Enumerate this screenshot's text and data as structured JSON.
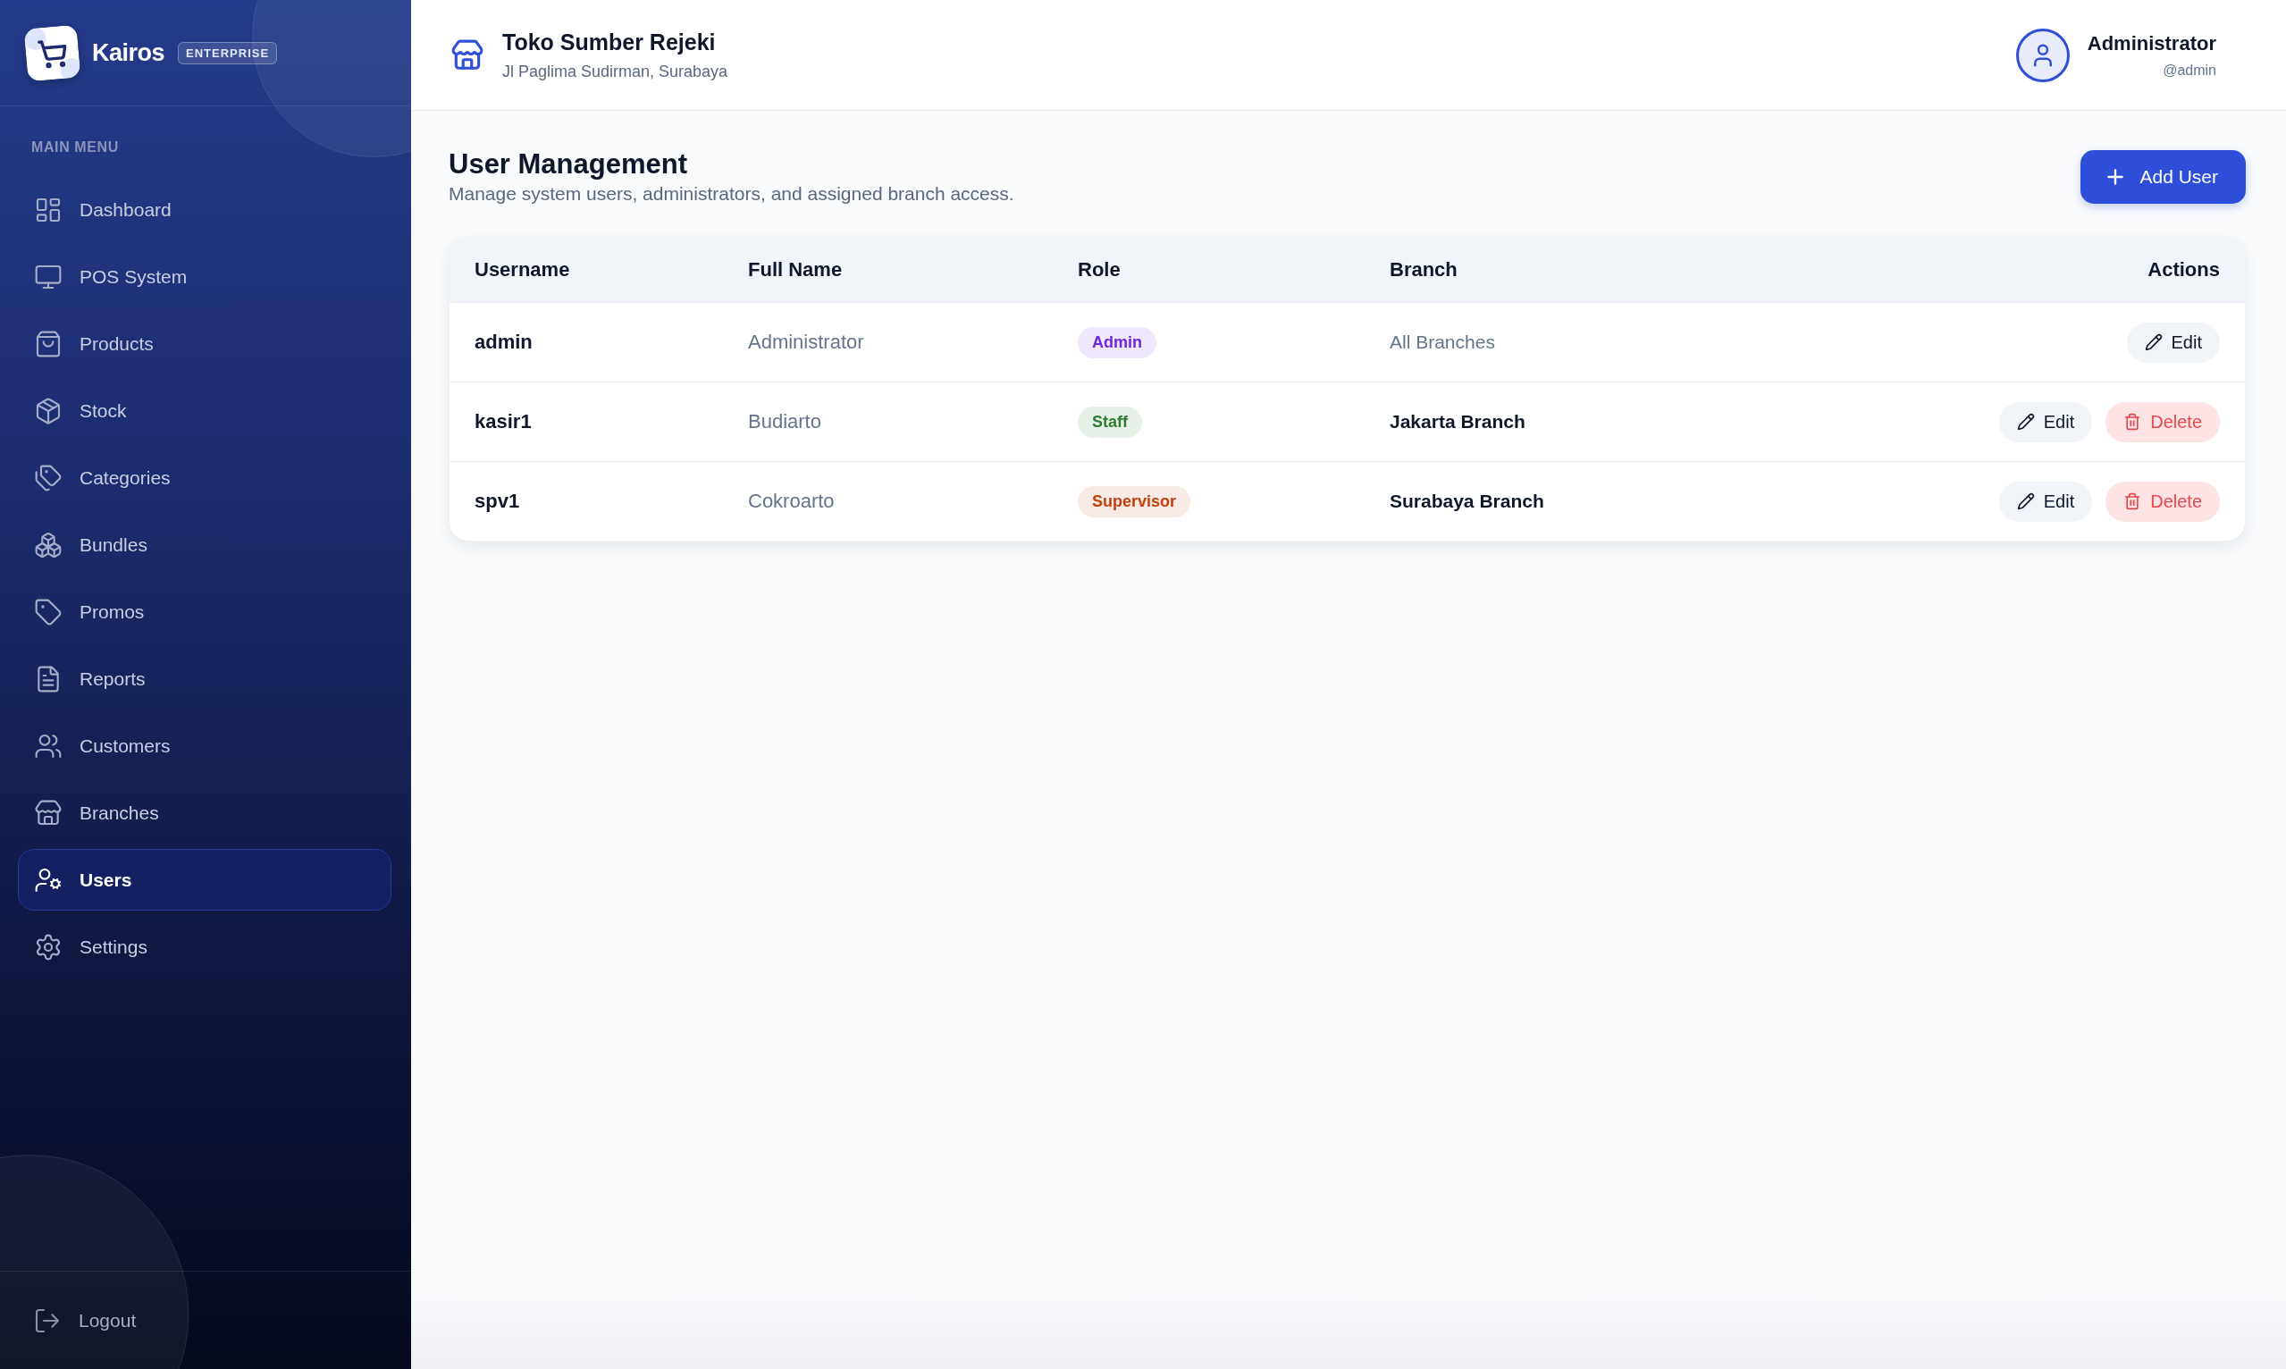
{
  "sidebar": {
    "brand": {
      "name": "Kairos",
      "badge": "ENTERPRISE"
    },
    "section_title": "MAIN MENU",
    "items": [
      {
        "label": "Dashboard",
        "selected": false
      },
      {
        "label": "POS System",
        "selected": false
      },
      {
        "label": "Products",
        "selected": false
      },
      {
        "label": "Stock",
        "selected": false
      },
      {
        "label": "Categories",
        "selected": false
      },
      {
        "label": "Bundles",
        "selected": false
      },
      {
        "label": "Promos",
        "selected": false
      },
      {
        "label": "Reports",
        "selected": false
      },
      {
        "label": "Customers",
        "selected": false
      },
      {
        "label": "Branches",
        "selected": false
      },
      {
        "label": "Users",
        "selected": true
      },
      {
        "label": "Settings",
        "selected": false
      }
    ],
    "logout": "Logout"
  },
  "header": {
    "store_name": "Toko Sumber Rejeki",
    "store_address": "Jl Paglima Sudirman, Surabaya",
    "user": {
      "name": "Administrator",
      "handle": "@admin"
    }
  },
  "page": {
    "title": "User Management",
    "subtitle": "Manage system users, administrators, and assigned branch access.",
    "add_button": "Add User"
  },
  "table": {
    "columns": [
      "Username",
      "Full Name",
      "Role",
      "Branch",
      "Actions"
    ],
    "rows": [
      {
        "username": "admin",
        "full_name": "Administrator",
        "role": {
          "label": "Admin",
          "color": "#6d28d9"
        },
        "branch": {
          "label": "All Branches",
          "kind": "all"
        },
        "actions": [
          {
            "label": "Edit",
            "kind": "edit"
          }
        ]
      },
      {
        "username": "kasir1",
        "full_name": "Budiarto",
        "role": {
          "label": "Staff",
          "color": "#2e7d32"
        },
        "branch": {
          "label": "Jakarta Branch",
          "kind": "single"
        },
        "actions": [
          {
            "label": "Edit",
            "kind": "edit"
          },
          {
            "label": "Delete",
            "kind": "delete"
          }
        ]
      },
      {
        "username": "spv1",
        "full_name": "Cokroarto",
        "role": {
          "label": "Supervisor",
          "color": "#c2410c"
        },
        "branch": {
          "label": "Surabaya Branch",
          "kind": "single"
        },
        "actions": [
          {
            "label": "Edit",
            "kind": "edit"
          },
          {
            "label": "Delete",
            "kind": "delete"
          }
        ]
      }
    ]
  }
}
